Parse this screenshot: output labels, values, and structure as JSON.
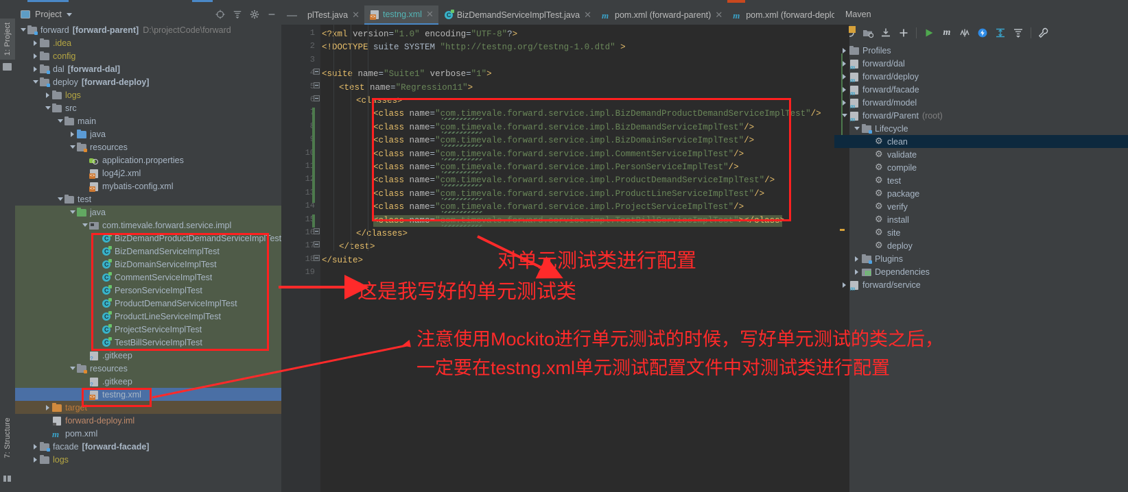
{
  "window": {
    "left_rail": [
      {
        "name": "project",
        "label": "1: Project"
      },
      {
        "name": "structure",
        "label": "7: Structure"
      }
    ]
  },
  "project_panel": {
    "title": "Project",
    "icons": [
      "locate-icon",
      "collapse-all-icon",
      "gear-icon",
      "minimize-icon"
    ],
    "tree": [
      {
        "depth": 0,
        "label": "forward",
        "bold_suffix": "[forward-parent]",
        "path": "D:\\projectCode\\forward",
        "icon": "module-folder-icon",
        "arrow": "down"
      },
      {
        "depth": 1,
        "label": ".idea",
        "icon": "folder-icon",
        "arrow": "right",
        "color": "#b5a642"
      },
      {
        "depth": 1,
        "label": "config",
        "icon": "folder-icon",
        "arrow": "right",
        "color": "#b5a642"
      },
      {
        "depth": 1,
        "label": "dal",
        "bold_suffix": "[forward-dal]",
        "icon": "module-folder-icon",
        "arrow": "right"
      },
      {
        "depth": 1,
        "label": "deploy",
        "bold_suffix": "[forward-deploy]",
        "icon": "module-folder-icon",
        "arrow": "down"
      },
      {
        "depth": 2,
        "label": "logs",
        "icon": "folder-icon",
        "arrow": "right",
        "color": "#b5a642"
      },
      {
        "depth": 2,
        "label": "src",
        "icon": "folder-icon",
        "arrow": "down"
      },
      {
        "depth": 3,
        "label": "main",
        "icon": "folder-icon",
        "arrow": "down"
      },
      {
        "depth": 4,
        "label": "java",
        "icon": "source-folder-icon",
        "arrow": "right"
      },
      {
        "depth": 4,
        "label": "resources",
        "icon": "resource-folder-icon",
        "arrow": "down"
      },
      {
        "depth": 5,
        "label": "application.properties",
        "icon": "properties-file-icon"
      },
      {
        "depth": 5,
        "label": "log4j2.xml",
        "icon": "xml-file-icon"
      },
      {
        "depth": 5,
        "label": "mybatis-config.xml",
        "icon": "xml-file-icon"
      },
      {
        "depth": 3,
        "label": "test",
        "icon": "folder-icon",
        "arrow": "down"
      },
      {
        "depth": 4,
        "label": "java",
        "icon": "test-source-folder-icon",
        "arrow": "down",
        "highlight": "green"
      },
      {
        "depth": 5,
        "label": "com.timevale.forward.service.impl",
        "icon": "package-icon",
        "arrow": "down",
        "highlight": "green"
      },
      {
        "depth": 6,
        "label": "BizDemandProductDemandServiceImplTest",
        "icon": "java-class-icon",
        "highlight": "green"
      },
      {
        "depth": 6,
        "label": "BizDemandServiceImplTest",
        "icon": "java-class-icon",
        "highlight": "green"
      },
      {
        "depth": 6,
        "label": "BizDomainServiceImplTest",
        "icon": "java-class-icon",
        "highlight": "green"
      },
      {
        "depth": 6,
        "label": "CommentServiceImplTest",
        "icon": "java-class-icon",
        "highlight": "green"
      },
      {
        "depth": 6,
        "label": "PersonServiceImplTest",
        "icon": "java-class-icon",
        "highlight": "green"
      },
      {
        "depth": 6,
        "label": "ProductDemandServiceImplTest",
        "icon": "java-class-icon",
        "highlight": "green"
      },
      {
        "depth": 6,
        "label": "ProductLineServiceImplTest",
        "icon": "java-class-icon",
        "highlight": "green"
      },
      {
        "depth": 6,
        "label": "ProjectServiceImplTest",
        "icon": "java-class-icon",
        "highlight": "green"
      },
      {
        "depth": 6,
        "label": "TestBillServiceImplTest",
        "icon": "java-class-icon",
        "highlight": "green"
      },
      {
        "depth": 5,
        "label": ".gitkeep",
        "icon": "unknown-file-icon",
        "highlight": "green"
      },
      {
        "depth": 4,
        "label": "resources",
        "icon": "test-resource-folder-icon",
        "arrow": "down",
        "highlight": "green"
      },
      {
        "depth": 5,
        "label": ".gitkeep",
        "icon": "unknown-file-icon",
        "highlight": "green"
      },
      {
        "depth": 5,
        "label": "testng.xml",
        "icon": "xml-file-icon",
        "highlight": "selected"
      },
      {
        "depth": 2,
        "label": "target",
        "icon": "excluded-folder-icon",
        "arrow": "right",
        "highlight": "brown",
        "color": "#c07b3a"
      },
      {
        "depth": 2,
        "label": "forward-deploy.iml",
        "icon": "iml-file-icon",
        "color": "#c08a6a"
      },
      {
        "depth": 2,
        "label": "pom.xml",
        "icon": "maven-pom-icon"
      },
      {
        "depth": 1,
        "label": "facade",
        "bold_suffix": "[forward-facade]",
        "icon": "module-folder-icon",
        "arrow": "right"
      },
      {
        "depth": 1,
        "label": "logs",
        "icon": "folder-icon",
        "arrow": "right",
        "color": "#b5a642"
      }
    ]
  },
  "editor": {
    "tabs": [
      {
        "label": "plTest.java",
        "icon": "java-class-icon",
        "active": false,
        "closable": true,
        "clipped": true
      },
      {
        "label": "testng.xml",
        "icon": "xml-file-icon",
        "active": true,
        "closable": true
      },
      {
        "label": "BizDemandServiceImplTest.java",
        "icon": "java-class-icon",
        "active": false,
        "closable": true
      },
      {
        "label": "pom.xml (forward-parent)",
        "icon": "maven-pom-icon",
        "active": false,
        "closable": true
      },
      {
        "label": "pom.xml (forward-deploy)",
        "icon": "maven-pom-icon",
        "active": false,
        "closable": true
      }
    ],
    "browser_popup": [
      "chrome-icon",
      "firefox-icon",
      "safari-icon",
      "opera-icon",
      "edge-icon"
    ],
    "line_numbers": [
      "1",
      "2",
      "3",
      "4",
      "5",
      "6",
      "7",
      "8",
      "9",
      "10",
      "11",
      "12",
      "13",
      "14",
      "15",
      "16",
      "17",
      "18",
      "19"
    ],
    "lines": [
      {
        "n": 1,
        "indent": 0,
        "html": "xml-decl",
        "text": "<?xml version=\"1.0\" encoding=\"UTF-8\"?>"
      },
      {
        "n": 2,
        "indent": 0,
        "text": "<!DOCTYPE suite SYSTEM \"http://testng.org/testng-1.0.dtd\" >"
      },
      {
        "n": 3,
        "indent": 0,
        "text": ""
      },
      {
        "n": 4,
        "indent": 0,
        "text": "<suite name=\"Suite1\" verbose=\"1\">"
      },
      {
        "n": 5,
        "indent": 1,
        "text": "<test name=\"Regression11\">"
      },
      {
        "n": 6,
        "indent": 2,
        "text": "<classes>"
      },
      {
        "n": 7,
        "indent": 3,
        "text": "<class name=\"com.timevale.forward.service.impl.BizDemandProductDemandServiceImplTest\"/>"
      },
      {
        "n": 8,
        "indent": 3,
        "text": "<class name=\"com.timevale.forward.service.impl.BizDemandServiceImplTest\"/>"
      },
      {
        "n": 9,
        "indent": 3,
        "text": "<class name=\"com.timevale.forward.service.impl.BizDomainServiceImplTest\"/>"
      },
      {
        "n": 10,
        "indent": 3,
        "text": "<class name=\"com.timevale.forward.service.impl.CommentServiceImplTest\"/>"
      },
      {
        "n": 11,
        "indent": 3,
        "text": "<class name=\"com.timevale.forward.service.impl.PersonServiceImplTest\"/>"
      },
      {
        "n": 12,
        "indent": 3,
        "text": "<class name=\"com.timevale.forward.service.impl.ProductDemandServiceImplTest\"/>"
      },
      {
        "n": 13,
        "indent": 3,
        "text": "<class name=\"com.timevale.forward.service.impl.ProductLineServiceImplTest\"/>"
      },
      {
        "n": 14,
        "indent": 3,
        "text": "<class name=\"com.timevale.forward.service.impl.ProjectServiceImplTest\"/>"
      },
      {
        "n": 15,
        "indent": 3,
        "text": "<class name=\"com.timevale.forward.service.impl.TestBillServiceImplTest\"></class>",
        "selected": true
      },
      {
        "n": 16,
        "indent": 2,
        "text": "</classes>"
      },
      {
        "n": 17,
        "indent": 1,
        "text": "</test>"
      },
      {
        "n": 18,
        "indent": 0,
        "text": "</suite>"
      },
      {
        "n": 19,
        "indent": 0,
        "text": ""
      }
    ]
  },
  "maven_panel": {
    "title": "Maven",
    "toolbar": [
      "reload-icon",
      "add-folder-icon",
      "download-sources-icon",
      "plus-icon",
      "run-icon",
      "execute-maven-goal-icon",
      "toggle-skip-tests-icon",
      "toggle-offline-icon",
      "expand-all-icon",
      "collapse-all-icon",
      "settings-wrench-icon"
    ],
    "tree": [
      {
        "depth": 0,
        "label": "Profiles",
        "icon": "profiles-icon",
        "arrow": "right"
      },
      {
        "depth": 0,
        "label": "forward/dal",
        "icon": "maven-module-icon",
        "arrow": "right"
      },
      {
        "depth": 0,
        "label": "forward/deploy",
        "icon": "maven-module-icon",
        "arrow": "right"
      },
      {
        "depth": 0,
        "label": "forward/facade",
        "icon": "maven-module-icon",
        "arrow": "right"
      },
      {
        "depth": 0,
        "label": "forward/model",
        "icon": "maven-module-icon",
        "arrow": "right"
      },
      {
        "depth": 0,
        "label": "forward/Parent",
        "sub": "(root)",
        "icon": "maven-module-icon",
        "arrow": "down"
      },
      {
        "depth": 1,
        "label": "Lifecycle",
        "icon": "lifecycle-folder-icon",
        "arrow": "down"
      },
      {
        "depth": 2,
        "label": "clean",
        "icon": "maven-goal-icon",
        "selected": true
      },
      {
        "depth": 2,
        "label": "validate",
        "icon": "maven-goal-icon"
      },
      {
        "depth": 2,
        "label": "compile",
        "icon": "maven-goal-icon"
      },
      {
        "depth": 2,
        "label": "test",
        "icon": "maven-goal-icon"
      },
      {
        "depth": 2,
        "label": "package",
        "icon": "maven-goal-icon"
      },
      {
        "depth": 2,
        "label": "verify",
        "icon": "maven-goal-icon"
      },
      {
        "depth": 2,
        "label": "install",
        "icon": "maven-goal-icon"
      },
      {
        "depth": 2,
        "label": "site",
        "icon": "maven-goal-icon"
      },
      {
        "depth": 2,
        "label": "deploy",
        "icon": "maven-goal-icon"
      },
      {
        "depth": 1,
        "label": "Plugins",
        "icon": "plugins-folder-icon",
        "arrow": "right"
      },
      {
        "depth": 1,
        "label": "Dependencies",
        "icon": "dependencies-icon",
        "arrow": "right"
      },
      {
        "depth": 0,
        "label": "forward/service",
        "icon": "maven-module-icon",
        "arrow": "right"
      }
    ]
  },
  "annotations": {
    "color": "#ff2a2a",
    "texts": [
      {
        "name": "annotation-configure-test-classes",
        "text": "对单元测试类进行配置"
      },
      {
        "name": "annotation-these-are-my-test-classes",
        "text": "这是我写好的单元测试类"
      },
      {
        "name": "annotation-mockito-note-line1",
        "text": "注意使用Mockito进行单元测试的时候，写好单元测试的类之后，"
      },
      {
        "name": "annotation-mockito-note-line2",
        "text": "一定要在testng.xml单元测试配置文件中对测试类进行配置"
      }
    ]
  }
}
